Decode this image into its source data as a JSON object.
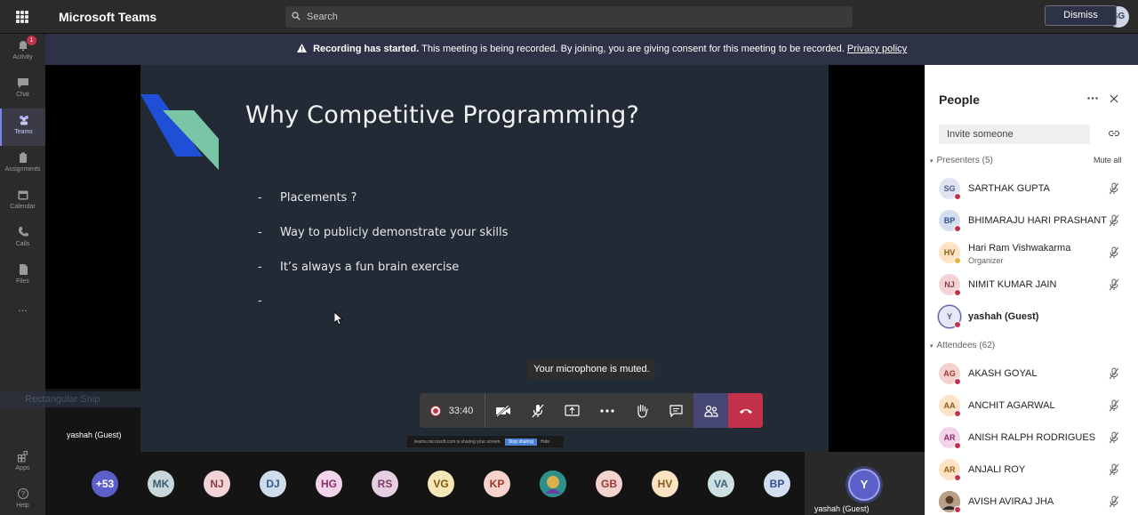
{
  "app": {
    "name": "Microsoft Teams",
    "search_placeholder": "Search",
    "user_initials": "SG"
  },
  "rail": [
    {
      "label": "Activity",
      "badge": "1"
    },
    {
      "label": "Chat"
    },
    {
      "label": "Teams",
      "active": true
    },
    {
      "label": "Assignments"
    },
    {
      "label": "Calendar"
    },
    {
      "label": "Calls"
    },
    {
      "label": "Files"
    },
    {
      "label": "..."
    },
    {
      "label": "Apps"
    },
    {
      "label": "Help"
    }
  ],
  "banner": {
    "bold": "Recording has started.",
    "text": "This meeting is being recorded. By joining, you are giving consent for this meeting to be recorded.",
    "link": "Privacy policy",
    "dismiss": "Dismiss"
  },
  "slide": {
    "title": "Why Competitive Programming?",
    "bullets": [
      "Placements ?",
      "Way to publicly demonstrate your skills",
      "It’s always a fun brain exercise",
      ""
    ]
  },
  "stage": {
    "left_video_name": "yashah (Guest)",
    "snip_label": "Rectangular Snip",
    "muted_tooltip": "Your microphone is muted.",
    "timer": "33:40",
    "share_text": "teams.microsoft.com is sharing your screen.",
    "share_stop": "Stop sharing",
    "share_hide": "Hide"
  },
  "strip": {
    "chips": [
      {
        "label": "+53",
        "bg": "#5b5fc7",
        "fg": "#ffffff"
      },
      {
        "label": "MK",
        "bg": "#c9d6dc",
        "fg": "#3b5d6b"
      },
      {
        "label": "NJ",
        "bg": "#f2d4d7",
        "fg": "#8a3a46"
      },
      {
        "label": "DJ",
        "bg": "#cfdcec",
        "fg": "#2f5b8f"
      },
      {
        "label": "HG",
        "bg": "#f2d4e8",
        "fg": "#8a2f6a"
      },
      {
        "label": "RS",
        "bg": "#e6cfe0",
        "fg": "#7a3b6c"
      },
      {
        "label": "VG",
        "bg": "#f7e7b6",
        "fg": "#7a5a0a"
      },
      {
        "label": "KP",
        "bg": "#f6d3cc",
        "fg": "#9a3a2a"
      },
      {
        "label": "",
        "bg": "#3aa7a0",
        "fg": "#ffffff"
      },
      {
        "label": "GB",
        "bg": "#f3d2cf",
        "fg": "#9a3b34"
      },
      {
        "label": "HV",
        "bg": "#fbe3c4",
        "fg": "#8a5a1a"
      },
      {
        "label": "VA",
        "bg": "#cfe0e4",
        "fg": "#3b6270"
      },
      {
        "label": "BP",
        "bg": "#d3def0",
        "fg": "#2f4f8a"
      }
    ],
    "self_initial": "Y",
    "self_name": "yashah (Guest)"
  },
  "people": {
    "title": "People",
    "invite_placeholder": "Invite someone",
    "presenters_label": "Presenters (5)",
    "mute_all": "Mute all",
    "presenters": [
      {
        "initials": "SG",
        "name": "SARTHAK GUPTA",
        "bg": "#dfe3f2",
        "fg": "#4f5a8a",
        "status": "#c4314b"
      },
      {
        "initials": "BP",
        "name": "BHIMARAJU HARI PRASHANT",
        "bg": "#d3def0",
        "fg": "#2f4f8a",
        "status": "#c4314b"
      },
      {
        "initials": "HV",
        "name": "Hari Ram Vishwakarma",
        "sub": "Organizer",
        "bg": "#fbe3c4",
        "fg": "#8a5a1a",
        "status": "#e3b53b"
      },
      {
        "initials": "NJ",
        "name": "NIMIT KUMAR JAIN",
        "bg": "#f2d4d7",
        "fg": "#8a3a46",
        "status": "#c4314b"
      },
      {
        "initials": "Y",
        "name": "yashah (Guest)",
        "bg": "#e6e8f7",
        "fg": "#4f5a8a",
        "status": "#c4314b",
        "self": true
      }
    ],
    "attendees_label": "Attendees (62)",
    "attendees": [
      {
        "initials": "AG",
        "name": "AKASH GOYAL",
        "bg": "#f3d2cf",
        "fg": "#9a3b34",
        "status": "#c4314b"
      },
      {
        "initials": "AA",
        "name": "ANCHIT AGARWAL",
        "bg": "#fbe3c4",
        "fg": "#8a5a1a",
        "status": "#c4314b"
      },
      {
        "initials": "AR",
        "name": "ANISH RALPH RODRIGUES",
        "bg": "#f2d4e8",
        "fg": "#8a2f6a",
        "status": "#c4314b"
      },
      {
        "initials": "AR",
        "name": "ANJALI ROY",
        "bg": "#fbe3c4",
        "fg": "#9a5a1a",
        "status": "#c4314b"
      },
      {
        "initials": "",
        "name": "AVISH AVIRAJ JHA",
        "bg": "#8a6a5a",
        "fg": "#ffffff",
        "status": "#c4314b"
      }
    ]
  }
}
